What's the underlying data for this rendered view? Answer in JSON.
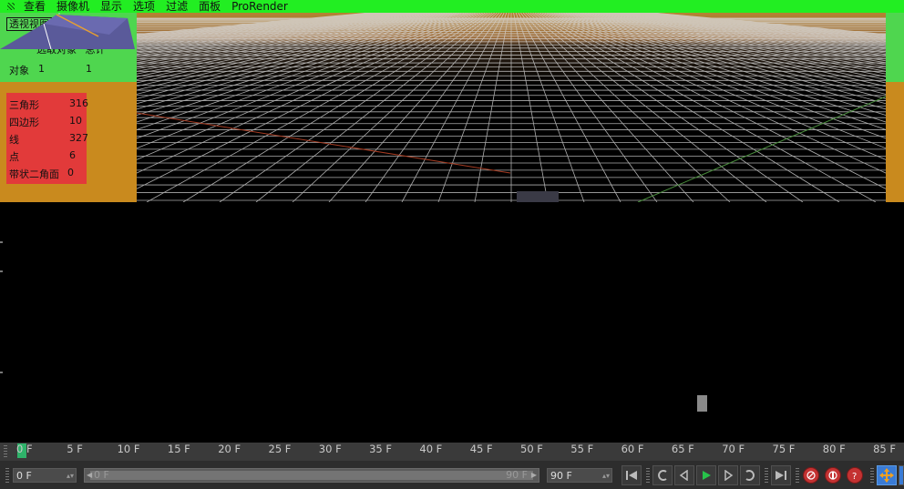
{
  "menubar": {
    "items": [
      "查看",
      "摄像机",
      "显示",
      "选项",
      "过滤",
      "面板",
      "ProRender"
    ]
  },
  "viewport": {
    "view_name": "透视视图",
    "selection_header": {
      "selected": "选取对象",
      "total": "总计"
    },
    "selection_row": {
      "label": "对象",
      "selected": "1",
      "total": "1"
    },
    "stats": [
      {
        "label": "三角形",
        "value": "316"
      },
      {
        "label": "四边形",
        "value": "10"
      },
      {
        "label": "线",
        "value": "327"
      },
      {
        "label": "点",
        "value": "6"
      },
      {
        "label": "带状二角面",
        "value": "0"
      }
    ]
  },
  "timeline": {
    "current_frame": "0 F",
    "ticks": [
      "0 F",
      "5 F",
      "10 F",
      "15 F",
      "20 F",
      "25 F",
      "30 F",
      "35 F",
      "40 F",
      "45 F",
      "50 F",
      "55 F",
      "60 F",
      "65 F",
      "70 F",
      "75 F",
      "80 F",
      "85 F"
    ]
  },
  "transport": {
    "current_field": "0 F",
    "range_start": "0 F",
    "range_end": "90 F",
    "end_field": "90 F"
  },
  "colors": {
    "menubar_bg": "#22ee22",
    "overlay_orange": "#c98a1e",
    "overlay_green": "#4fd64f",
    "stats_red": "#e23a3a",
    "playhead": "#2fb26a",
    "move_tool": "#3a7bd5"
  }
}
